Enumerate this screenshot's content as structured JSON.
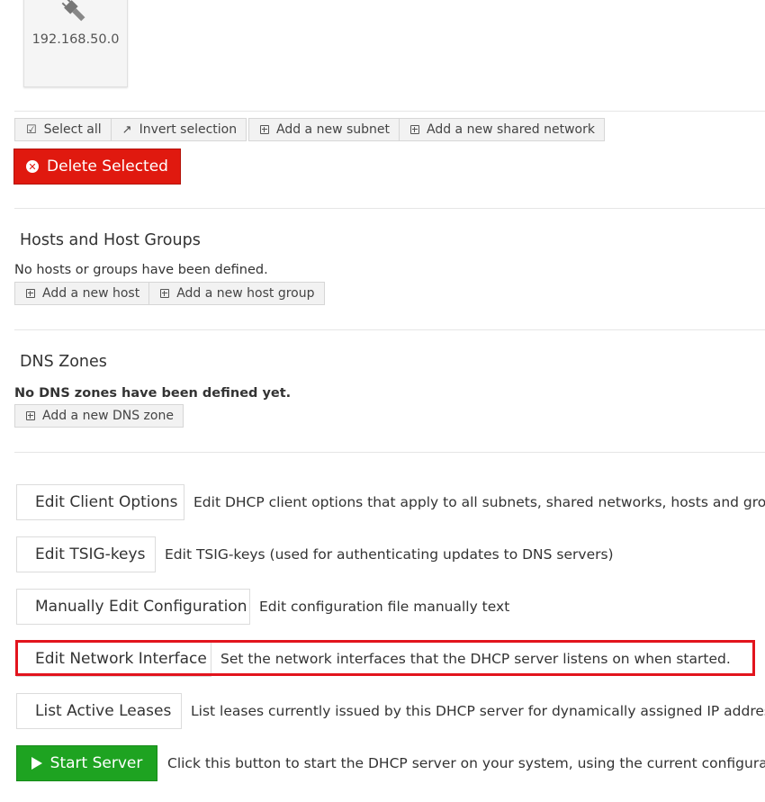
{
  "subnet_tile": {
    "label": "192.168.50.0",
    "icon": "network-cable-icon"
  },
  "subnet_toolbar": {
    "select_all": "Select all",
    "invert_selection": "Invert selection",
    "add_subnet": "Add a new subnet",
    "add_shared_network": "Add a new shared network"
  },
  "delete_selected": "Delete Selected",
  "hosts": {
    "title": "Hosts and Host Groups",
    "empty_text": "No hosts or groups have been defined.",
    "add_host": "Add a new host",
    "add_host_group": "Add a new host group"
  },
  "dns": {
    "title": "DNS Zones",
    "empty_text": "No DNS zones have been defined yet.",
    "add_zone": "Add a new DNS zone"
  },
  "actions": [
    {
      "label": "Edit Client Options",
      "desc": "Edit DHCP client options that apply to all subnets, shared networks, hosts and groups"
    },
    {
      "label": "Edit TSIG-keys",
      "desc": "Edit TSIG-keys (used for authenticating updates to DNS servers)"
    },
    {
      "label": "Manually Edit Configuration",
      "desc": "Edit configuration file manually text"
    },
    {
      "label": "Edit Network Interface",
      "desc": "Set the network interfaces that the DHCP server listens on when started."
    },
    {
      "label": "List Active Leases",
      "desc": "List leases currently issued by this DHCP server for dynamically assigned IP addresses."
    },
    {
      "label": "Start Server",
      "desc": "Click this button to start the DHCP server on your system, using the current configuration."
    }
  ],
  "colors": {
    "delete": "#e0190f",
    "start": "#1ea321",
    "highlight": "#e2141d"
  }
}
